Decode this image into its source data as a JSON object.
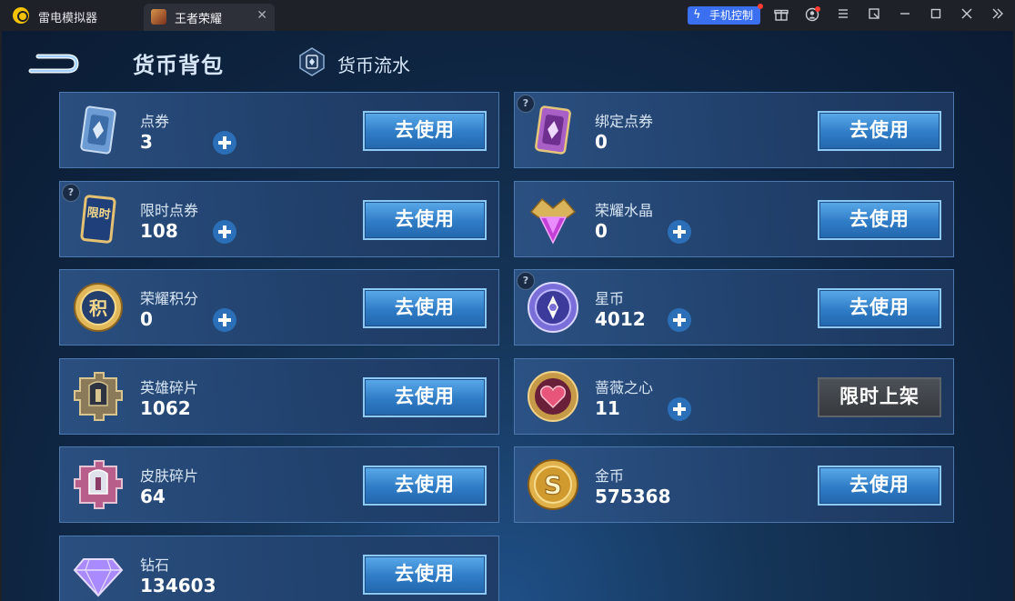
{
  "window": {
    "app_name": "雷电模拟器",
    "tab_label": "王者荣耀",
    "tab_close": "✕",
    "phone_control": "手机控制",
    "controls": [
      "▭",
      "◔",
      "≡",
      "⤢",
      "—",
      "☐",
      "✕",
      "»"
    ]
  },
  "header": {
    "title": "货币背包",
    "flow_label": "货币流水"
  },
  "currencies": [
    {
      "name": "点券",
      "amount": "3",
      "has_plus": true,
      "has_help": false,
      "button": "去使用"
    },
    {
      "name": "绑定点券",
      "amount": "0",
      "has_plus": false,
      "has_help": true,
      "button": "去使用"
    },
    {
      "name": "限时点券",
      "amount": "108",
      "has_plus": true,
      "has_help": true,
      "button": "去使用",
      "icon_text": "限时"
    },
    {
      "name": "荣耀水晶",
      "amount": "0",
      "has_plus": true,
      "has_help": false,
      "button": "去使用"
    },
    {
      "name": "荣耀积分",
      "amount": "0",
      "has_plus": true,
      "has_help": false,
      "button": "去使用",
      "icon_text": "积"
    },
    {
      "name": "星币",
      "amount": "4012",
      "has_plus": true,
      "has_help": true,
      "button": "去使用"
    },
    {
      "name": "英雄碎片",
      "amount": "1062",
      "has_plus": false,
      "has_help": false,
      "button": "去使用"
    },
    {
      "name": "蔷薇之心",
      "amount": "11",
      "has_plus": true,
      "has_help": false,
      "button": "限时上架"
    },
    {
      "name": "皮肤碎片",
      "amount": "64",
      "has_plus": false,
      "has_help": false,
      "button": "去使用"
    },
    {
      "name": "金币",
      "amount": "575368",
      "has_plus": false,
      "has_help": false,
      "button": "去使用",
      "icon_text": "S"
    },
    {
      "name": "钻石",
      "amount": "134603",
      "has_plus": false,
      "has_help": false,
      "button": "去使用"
    }
  ],
  "colors": {
    "button_blue": "#2f7cc6",
    "limit_grey": "#3e4248",
    "card_border": "#4b78ae",
    "accent": "#3a6ff0"
  }
}
